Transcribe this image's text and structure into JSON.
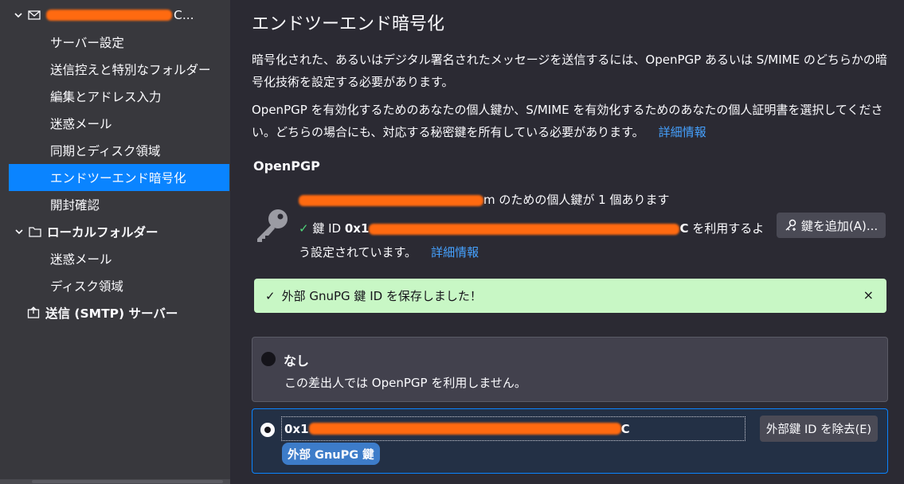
{
  "sidebar": {
    "account": {
      "name_redacted": "redacted email",
      "suffix": "C..."
    },
    "items": [
      {
        "label": "サーバー設定"
      },
      {
        "label": "送信控えと特別なフォルダー"
      },
      {
        "label": "編集とアドレス入力"
      },
      {
        "label": "迷惑メール"
      },
      {
        "label": "同期とディスク領域"
      },
      {
        "label": "エンドツーエンド暗号化"
      },
      {
        "label": "開封確認"
      }
    ],
    "local_folders": {
      "label": "ローカルフォルダー",
      "items": [
        {
          "label": "迷惑メール"
        },
        {
          "label": "ディスク領域"
        }
      ]
    },
    "smtp": {
      "label": "送信 (SMTP) サーバー"
    }
  },
  "main": {
    "title": "エンドツーエンド暗号化",
    "para1": "暗号化された、あるいはデジタル署名されたメッセージを送信するには、OpenPGP あるいは S/MIME のどちらかの暗号化技術を設定する必要があります。",
    "para2": "OpenPGP を有効化するためのあなたの個人鍵か、S/MIME を有効化するためのあなたの個人証明書を選択してください。どちらの場合にも、対応する秘密鍵を所有している必要があります。",
    "para2_link": "詳細情報",
    "openpgp_heading": "OpenPGP",
    "personal_key_email_tail": "m",
    "personal_key_text": " のための個人鍵が 1 個あります",
    "check": "✓",
    "keyid_prefix": "鍵 ID ",
    "keyid_start": "0x1",
    "keyid_end": "C",
    "keyid_text": " を利用するよう設定されています。",
    "keyid_link": "詳細情報",
    "add_key_button": "鍵を追加(A)...",
    "success_message": "外部 GnuPG 鍵 ID を保存しました！",
    "success_close": "×",
    "option_none": {
      "title": "なし",
      "desc": "この差出人では OpenPGP を利用しません。"
    },
    "option_key": {
      "id_start": "0x1",
      "id_end": "C",
      "remove_button": "外部鍵 ID を除去(E)",
      "badge": "外部 GnuPG 鍵"
    }
  }
}
